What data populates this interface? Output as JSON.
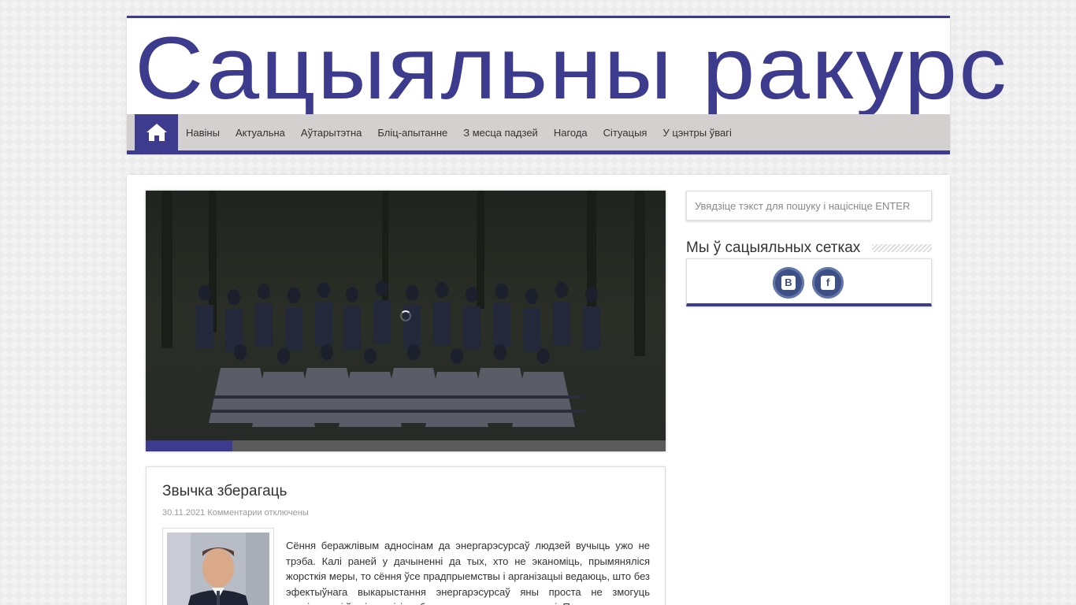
{
  "site": {
    "logo_text": "Сацыяльны ракурс",
    "brand_color": "#3d3b8e"
  },
  "nav": {
    "home_icon": "home-icon",
    "items": [
      {
        "label": "Навіны"
      },
      {
        "label": "Актуальна"
      },
      {
        "label": "Аўтарытэтна"
      },
      {
        "label": "Бліц-апытанне"
      },
      {
        "label": "З месца падзей"
      },
      {
        "label": "Нагода"
      },
      {
        "label": "Сітуацыя"
      },
      {
        "label": "У цэнтры ўвагі"
      }
    ]
  },
  "slider": {
    "progress": 0.167
  },
  "post": {
    "title": "Звычка зберагаць",
    "date": "30.11.2021",
    "comments": "Комментарии отключены",
    "excerpt": "Сёння беражлівым адносінам да энергарэсурсаў людзей вучыць ужо не трэба. Калі раней у дачыненні да тых, хто не эканоміць, прымяняліся жорсткія меры, то сёння ўсе прадпрыемствы і арганізацыі ведаюць, што без эфектыўнага выкарыстання энергарэсурсаў яны проста не змогуць развівацца і ўсе іх вынікі не будуць канкурэнтаздольнымі. Пра гэта, чаму"
  },
  "sidebar": {
    "search_placeholder": "Увядзіце тэкст для пошуку і націсніце ENTER",
    "social_title": "Мы ў сацыяльных сетках",
    "social": [
      {
        "icon": "vk-icon",
        "glyph": "В"
      },
      {
        "icon": "facebook-icon",
        "glyph": "f"
      }
    ]
  }
}
